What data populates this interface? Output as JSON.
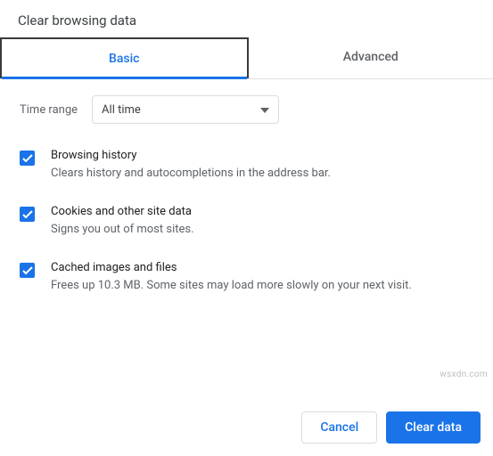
{
  "title": "Clear browsing data",
  "tabs": {
    "basic": "Basic",
    "advanced": "Advanced"
  },
  "timerange": {
    "label": "Time range",
    "value": "All time"
  },
  "options": [
    {
      "title": "Browsing history",
      "desc": "Clears history and autocompletions in the address bar."
    },
    {
      "title": "Cookies and other site data",
      "desc": "Signs you out of most sites."
    },
    {
      "title": "Cached images and files",
      "desc": "Frees up 10.3 MB. Some sites may load more slowly on your next visit."
    }
  ],
  "buttons": {
    "cancel": "Cancel",
    "clear": "Clear data"
  },
  "watermark": "wsxdn.com"
}
